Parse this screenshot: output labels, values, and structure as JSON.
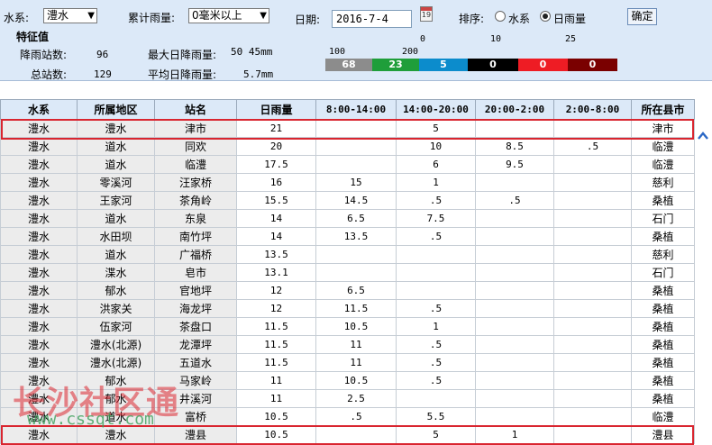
{
  "filters": {
    "water_system_label": "水系:",
    "water_system_value": "澧水",
    "cumulative_rain_label": "累计雨量:",
    "cumulative_rain_value": "0毫米以上",
    "date_label": "日期:",
    "date_value": "2016-7-4",
    "sort_label": "排序:",
    "sort_options": [
      "水系",
      "日雨量"
    ],
    "sort_selected": "日雨量",
    "confirm_label": "确定"
  },
  "stats": {
    "title": "特征值",
    "rain_stations_label": "降雨站数:",
    "rain_stations_value": "96",
    "total_stations_label": "总站数:",
    "total_stations_value": "129",
    "max_daily_label": "最大日降雨量:",
    "max_daily_value": "50 45mm",
    "avg_daily_label": "平均日降雨量:",
    "avg_daily_value": "5.7mm"
  },
  "legend": {
    "thresholds": [
      "100",
      "200",
      "0",
      "10",
      "25"
    ],
    "bars": [
      {
        "count": "68",
        "color": "#8c8c8c"
      },
      {
        "count": "23",
        "color": "#1f9e3a"
      },
      {
        "count": "5",
        "color": "#0c8ccc"
      },
      {
        "count": "0",
        "color": "#000000"
      },
      {
        "count": "0",
        "color": "#ee1c24"
      },
      {
        "count": "0",
        "color": "#7a0000"
      }
    ]
  },
  "table": {
    "columns": [
      "水系",
      "所属地区",
      "站名",
      "日雨量",
      "8:00-14:00",
      "14:00-20:00",
      "20:00-2:00",
      "2:00-8:00",
      "所在县市"
    ],
    "rows": [
      [
        "澧水",
        "澧水",
        "津市",
        "21",
        "",
        "5",
        "",
        "",
        "津市"
      ],
      [
        "澧水",
        "道水",
        "同欢",
        "20",
        "",
        "10",
        "8.5",
        ".5",
        "临澧"
      ],
      [
        "澧水",
        "道水",
        "临澧",
        "17.5",
        "",
        "6",
        "9.5",
        "",
        "临澧"
      ],
      [
        "澧水",
        "零溪河",
        "汪家桥",
        "16",
        "15",
        "1",
        "",
        "",
        "慈利"
      ],
      [
        "澧水",
        "王家河",
        "茶角岭",
        "15.5",
        "14.5",
        ".5",
        ".5",
        "",
        "桑植"
      ],
      [
        "澧水",
        "道水",
        "东泉",
        "14",
        "6.5",
        "7.5",
        "",
        "",
        "石门"
      ],
      [
        "澧水",
        "水田坝",
        "南竹坪",
        "14",
        "13.5",
        ".5",
        "",
        "",
        "桑植"
      ],
      [
        "澧水",
        "道水",
        "广福桥",
        "13.5",
        "",
        "",
        "",
        "",
        "慈利"
      ],
      [
        "澧水",
        "渫水",
        "皂市",
        "13.1",
        "",
        "",
        "",
        "",
        "石门"
      ],
      [
        "澧水",
        "郁水",
        "官地坪",
        "12",
        "6.5",
        "",
        "",
        "",
        "桑植"
      ],
      [
        "澧水",
        "洪家关",
        "海龙坪",
        "12",
        "11.5",
        ".5",
        "",
        "",
        "桑植"
      ],
      [
        "澧水",
        "伍家河",
        "茶盘口",
        "11.5",
        "10.5",
        "1",
        "",
        "",
        "桑植"
      ],
      [
        "澧水",
        "澧水(北源)",
        "龙潭坪",
        "11.5",
        "11",
        ".5",
        "",
        "",
        "桑植"
      ],
      [
        "澧水",
        "澧水(北源)",
        "五道水",
        "11.5",
        "11",
        ".5",
        "",
        "",
        "桑植"
      ],
      [
        "澧水",
        "郁水",
        "马家岭",
        "11",
        "10.5",
        ".5",
        "",
        "",
        "桑植"
      ],
      [
        "澧水",
        "郁水",
        "井溪河",
        "11",
        "2.5",
        "",
        "",
        "",
        "桑植"
      ],
      [
        "澧水",
        "道水",
        "富桥",
        "10.5",
        ".5",
        "5.5",
        "",
        "",
        "临澧"
      ],
      [
        "澧水",
        "澧水",
        "澧县",
        "10.5",
        "",
        "5",
        "1",
        "",
        "澧县"
      ]
    ]
  },
  "watermark": {
    "text": "长沙社区通",
    "url": "www.cssqt.com"
  }
}
